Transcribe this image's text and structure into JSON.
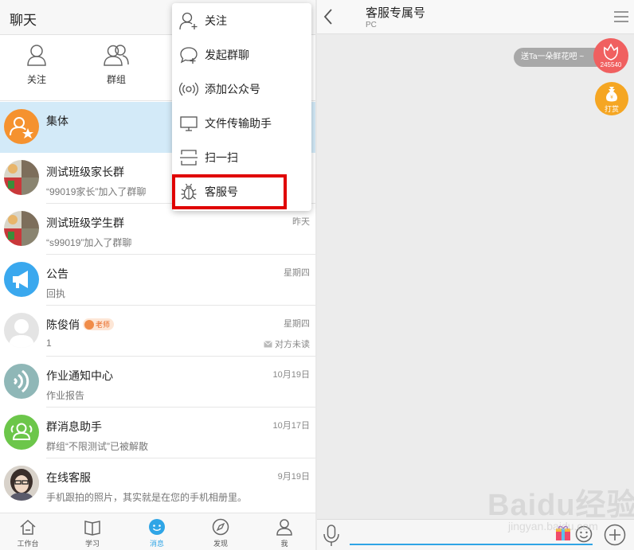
{
  "left": {
    "title": "聊天",
    "quick_actions": [
      {
        "label": "关注",
        "icon": "person-icon"
      },
      {
        "label": "群组",
        "icon": "group-icon"
      }
    ],
    "conversations": [
      {
        "name": "集体",
        "preview": "",
        "time": "",
        "status": "",
        "avatar_color": "#f5922f",
        "selected": true
      },
      {
        "name": "测试班级家长群",
        "preview": "“99019家长”加入了群聊",
        "time": "",
        "status": ""
      },
      {
        "name": "测试班级学生群",
        "preview": "“s99019”加入了群聊",
        "time": "昨天",
        "status": ""
      },
      {
        "name": "公告",
        "preview": "回执",
        "time": "星期四",
        "status": "",
        "avatar_color": "#3aa8ee"
      },
      {
        "name": "陈俊俏",
        "badge": "老师",
        "preview": "1",
        "time": "星期四",
        "status": "对方未读",
        "avatar_color": "#dddddd"
      },
      {
        "name": "作业通知中心",
        "preview": "作业报告",
        "time": "10月19日",
        "status": "",
        "avatar_color": "#8fb7b7"
      },
      {
        "name": "群消息助手",
        "preview": "群组“不限测试”已被解散",
        "time": "10月17日",
        "status": "",
        "avatar_color": "#6cc64a"
      },
      {
        "name": "在线客服",
        "preview": "手机跟拍的照片，其实就是在您的手机相册里。",
        "time": "9月19日",
        "status": ""
      }
    ],
    "tabs": [
      {
        "label": "工作台",
        "icon": "home-icon"
      },
      {
        "label": "学习",
        "icon": "book-icon"
      },
      {
        "label": "消息",
        "icon": "message-icon",
        "active": true
      },
      {
        "label": "发现",
        "icon": "compass-icon"
      },
      {
        "label": "我",
        "icon": "user-icon"
      }
    ]
  },
  "menu": {
    "items": [
      {
        "label": "关注",
        "icon": "follow-icon"
      },
      {
        "label": "发起群聊",
        "icon": "chat-bubble-icon"
      },
      {
        "label": "添加公众号",
        "icon": "broadcast-icon"
      },
      {
        "label": "文件传输助手",
        "icon": "monitor-icon"
      },
      {
        "label": "扫一扫",
        "icon": "scan-icon"
      },
      {
        "label": "客服号",
        "icon": "bug-icon",
        "highlighted": true
      }
    ]
  },
  "right": {
    "title": "客服专属号",
    "subtitle": "PC",
    "gift_prompt": "送Ta一朵鲜花吧 ~",
    "flower_count": "245540",
    "reward_label": "打赏"
  },
  "watermark": {
    "main": "Baidu经验",
    "sub": "jingyan.baidu.com"
  },
  "colors": {
    "accent": "#2fa5e6",
    "highlight_border": "#e00000",
    "selected_row": "#d3eaf8"
  }
}
